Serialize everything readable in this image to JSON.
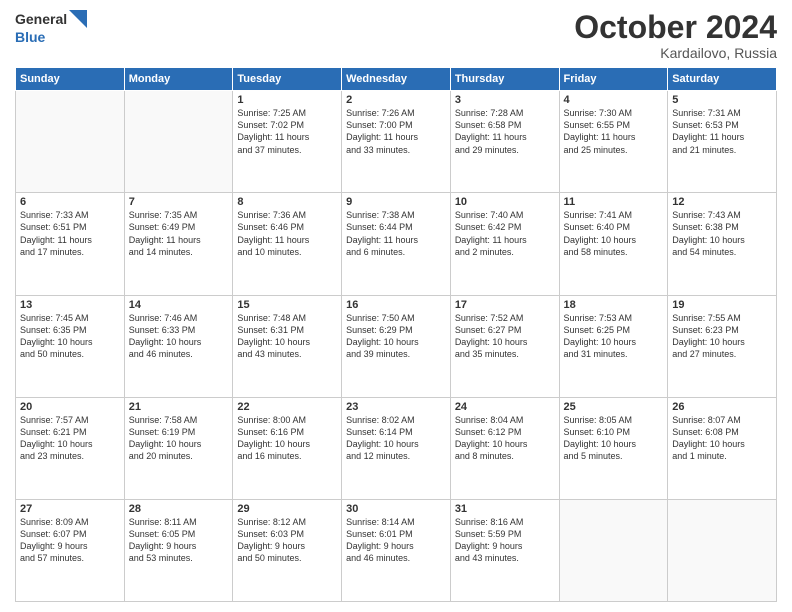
{
  "logo": {
    "line1": "General",
    "line2": "Blue",
    "icon_color": "#2a6db5"
  },
  "title": "October 2024",
  "location": "Kardailovo, Russia",
  "weekdays": [
    "Sunday",
    "Monday",
    "Tuesday",
    "Wednesday",
    "Thursday",
    "Friday",
    "Saturday"
  ],
  "weeks": [
    [
      {
        "day": "",
        "detail": ""
      },
      {
        "day": "",
        "detail": ""
      },
      {
        "day": "1",
        "detail": "Sunrise: 7:25 AM\nSunset: 7:02 PM\nDaylight: 11 hours\nand 37 minutes."
      },
      {
        "day": "2",
        "detail": "Sunrise: 7:26 AM\nSunset: 7:00 PM\nDaylight: 11 hours\nand 33 minutes."
      },
      {
        "day": "3",
        "detail": "Sunrise: 7:28 AM\nSunset: 6:58 PM\nDaylight: 11 hours\nand 29 minutes."
      },
      {
        "day": "4",
        "detail": "Sunrise: 7:30 AM\nSunset: 6:55 PM\nDaylight: 11 hours\nand 25 minutes."
      },
      {
        "day": "5",
        "detail": "Sunrise: 7:31 AM\nSunset: 6:53 PM\nDaylight: 11 hours\nand 21 minutes."
      }
    ],
    [
      {
        "day": "6",
        "detail": "Sunrise: 7:33 AM\nSunset: 6:51 PM\nDaylight: 11 hours\nand 17 minutes."
      },
      {
        "day": "7",
        "detail": "Sunrise: 7:35 AM\nSunset: 6:49 PM\nDaylight: 11 hours\nand 14 minutes."
      },
      {
        "day": "8",
        "detail": "Sunrise: 7:36 AM\nSunset: 6:46 PM\nDaylight: 11 hours\nand 10 minutes."
      },
      {
        "day": "9",
        "detail": "Sunrise: 7:38 AM\nSunset: 6:44 PM\nDaylight: 11 hours\nand 6 minutes."
      },
      {
        "day": "10",
        "detail": "Sunrise: 7:40 AM\nSunset: 6:42 PM\nDaylight: 11 hours\nand 2 minutes."
      },
      {
        "day": "11",
        "detail": "Sunrise: 7:41 AM\nSunset: 6:40 PM\nDaylight: 10 hours\nand 58 minutes."
      },
      {
        "day": "12",
        "detail": "Sunrise: 7:43 AM\nSunset: 6:38 PM\nDaylight: 10 hours\nand 54 minutes."
      }
    ],
    [
      {
        "day": "13",
        "detail": "Sunrise: 7:45 AM\nSunset: 6:35 PM\nDaylight: 10 hours\nand 50 minutes."
      },
      {
        "day": "14",
        "detail": "Sunrise: 7:46 AM\nSunset: 6:33 PM\nDaylight: 10 hours\nand 46 minutes."
      },
      {
        "day": "15",
        "detail": "Sunrise: 7:48 AM\nSunset: 6:31 PM\nDaylight: 10 hours\nand 43 minutes."
      },
      {
        "day": "16",
        "detail": "Sunrise: 7:50 AM\nSunset: 6:29 PM\nDaylight: 10 hours\nand 39 minutes."
      },
      {
        "day": "17",
        "detail": "Sunrise: 7:52 AM\nSunset: 6:27 PM\nDaylight: 10 hours\nand 35 minutes."
      },
      {
        "day": "18",
        "detail": "Sunrise: 7:53 AM\nSunset: 6:25 PM\nDaylight: 10 hours\nand 31 minutes."
      },
      {
        "day": "19",
        "detail": "Sunrise: 7:55 AM\nSunset: 6:23 PM\nDaylight: 10 hours\nand 27 minutes."
      }
    ],
    [
      {
        "day": "20",
        "detail": "Sunrise: 7:57 AM\nSunset: 6:21 PM\nDaylight: 10 hours\nand 23 minutes."
      },
      {
        "day": "21",
        "detail": "Sunrise: 7:58 AM\nSunset: 6:19 PM\nDaylight: 10 hours\nand 20 minutes."
      },
      {
        "day": "22",
        "detail": "Sunrise: 8:00 AM\nSunset: 6:16 PM\nDaylight: 10 hours\nand 16 minutes."
      },
      {
        "day": "23",
        "detail": "Sunrise: 8:02 AM\nSunset: 6:14 PM\nDaylight: 10 hours\nand 12 minutes."
      },
      {
        "day": "24",
        "detail": "Sunrise: 8:04 AM\nSunset: 6:12 PM\nDaylight: 10 hours\nand 8 minutes."
      },
      {
        "day": "25",
        "detail": "Sunrise: 8:05 AM\nSunset: 6:10 PM\nDaylight: 10 hours\nand 5 minutes."
      },
      {
        "day": "26",
        "detail": "Sunrise: 8:07 AM\nSunset: 6:08 PM\nDaylight: 10 hours\nand 1 minute."
      }
    ],
    [
      {
        "day": "27",
        "detail": "Sunrise: 8:09 AM\nSunset: 6:07 PM\nDaylight: 9 hours\nand 57 minutes."
      },
      {
        "day": "28",
        "detail": "Sunrise: 8:11 AM\nSunset: 6:05 PM\nDaylight: 9 hours\nand 53 minutes."
      },
      {
        "day": "29",
        "detail": "Sunrise: 8:12 AM\nSunset: 6:03 PM\nDaylight: 9 hours\nand 50 minutes."
      },
      {
        "day": "30",
        "detail": "Sunrise: 8:14 AM\nSunset: 6:01 PM\nDaylight: 9 hours\nand 46 minutes."
      },
      {
        "day": "31",
        "detail": "Sunrise: 8:16 AM\nSunset: 5:59 PM\nDaylight: 9 hours\nand 43 minutes."
      },
      {
        "day": "",
        "detail": ""
      },
      {
        "day": "",
        "detail": ""
      }
    ]
  ]
}
